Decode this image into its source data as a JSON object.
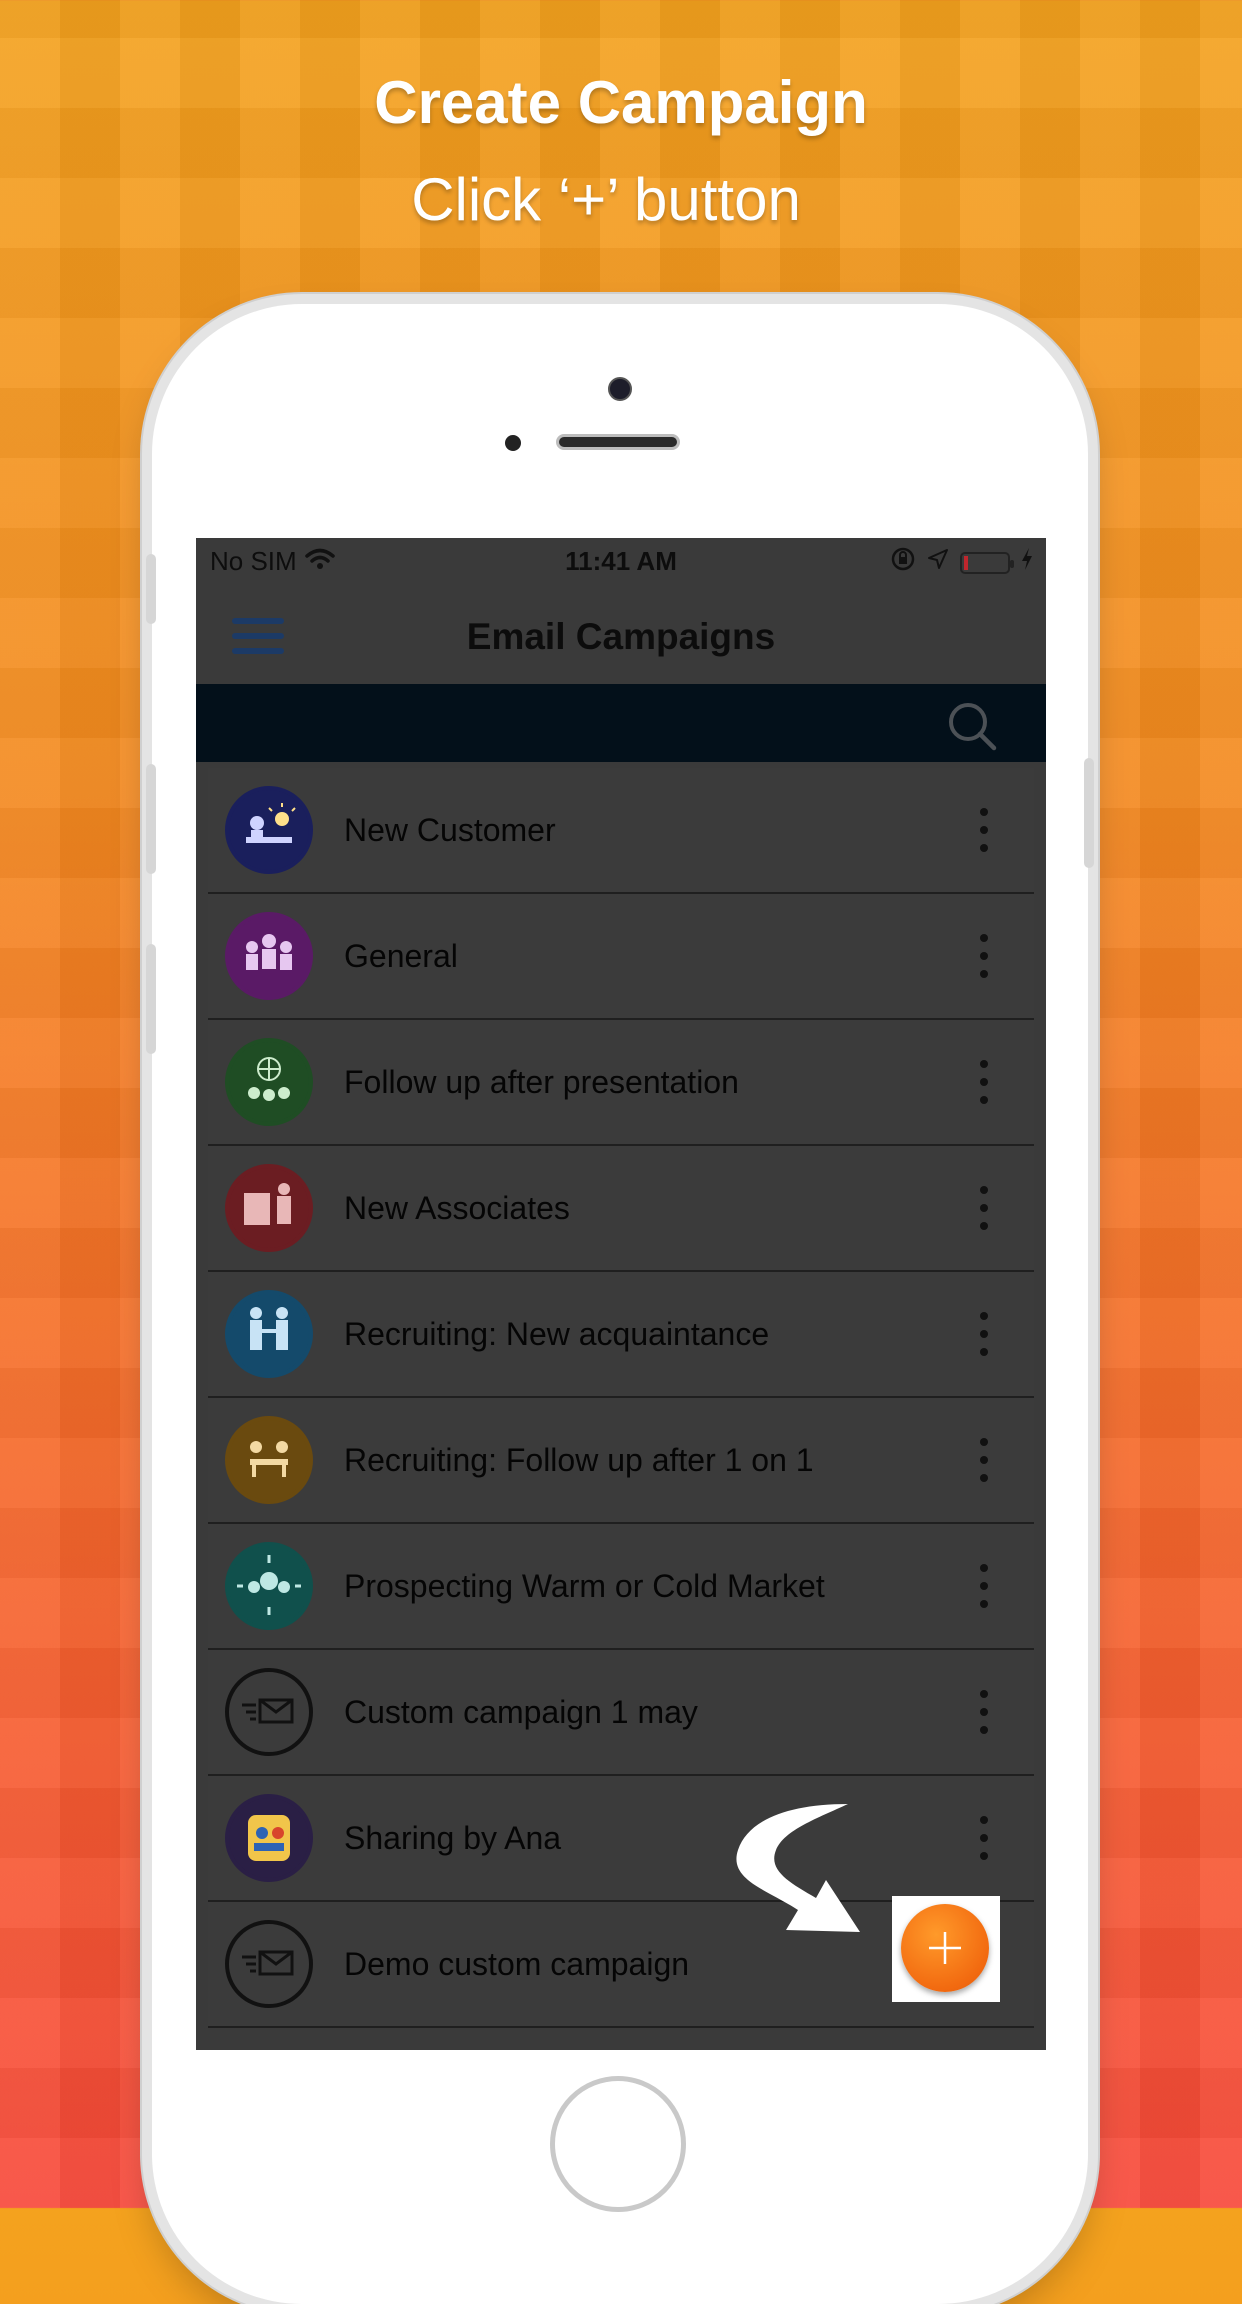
{
  "promo": {
    "headline": "Create Campaign",
    "subheadline": "Click ‘+’ button"
  },
  "status_bar": {
    "carrier": "No SIM",
    "time": "11:41 AM"
  },
  "app_bar": {
    "title": "Email Campaigns"
  },
  "campaigns": [
    {
      "label": "New Customer",
      "icon": "presentation-icon",
      "color": "#1a1f5c"
    },
    {
      "label": "General",
      "icon": "team-icon",
      "color": "#5a1a66"
    },
    {
      "label": "Follow up after presentation",
      "icon": "globe-team-icon",
      "color": "#1f4d24"
    },
    {
      "label": "New Associates",
      "icon": "business-people-icon",
      "color": "#6b1d22"
    },
    {
      "label": "Recruiting: New acquaintance",
      "icon": "handshake-icon",
      "color": "#144a6b"
    },
    {
      "label": "Recruiting: Follow up after 1 on 1",
      "icon": "meeting-icon",
      "color": "#6a4a0f"
    },
    {
      "label": "Prospecting Warm or Cold Market",
      "icon": "group-icon",
      "color": "#10504c"
    },
    {
      "label": "Custom campaign 1 may",
      "icon": "fast-mail-icon",
      "color": "#3a3a3a"
    },
    {
      "label": "Sharing by Ana",
      "icon": "sharing-icon",
      "color": "#2a1f45"
    },
    {
      "label": "Demo custom campaign",
      "icon": "fast-mail-icon",
      "color": "#3a3a3a"
    }
  ],
  "fab": {
    "label": "+",
    "color": "#f26a10"
  }
}
